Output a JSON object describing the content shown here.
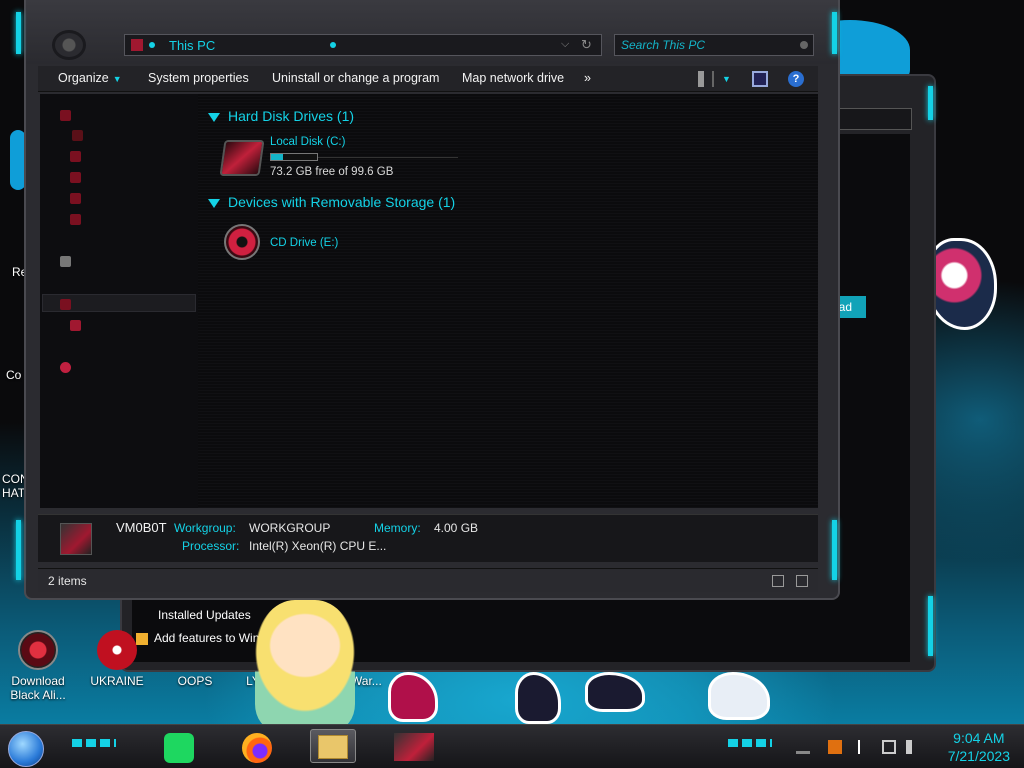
{
  "window": {
    "address_crumb": "This PC",
    "search_placeholder": "Search This PC"
  },
  "toolbar": {
    "organize": "Organize",
    "system_properties": "System properties",
    "uninstall": "Uninstall or change a program",
    "map_network": "Map network drive",
    "more": "»"
  },
  "groups": [
    {
      "title": "Hard Disk Drives (1)"
    },
    {
      "title": "Devices with Removable Storage (1)"
    }
  ],
  "drives": {
    "c": {
      "name": "Local Disk (C:)",
      "free_text": "73.2 GB free of 99.6 GB",
      "used_fraction": 0.27
    },
    "e": {
      "name": "CD Drive (E:)"
    }
  },
  "details": {
    "computer_name": "VM0B0T",
    "workgroup_label": "Workgroup:",
    "workgroup_value": "WORKGROUP",
    "memory_label": "Memory:",
    "memory_value": "4.00 GB",
    "processor_label": "Processor:",
    "processor_value": "Intel(R) Xeon(R) CPU E..."
  },
  "status": {
    "item_count": "2 items"
  },
  "back_window": {
    "button_label": "oad",
    "list_items": [
      "Installed Updates",
      "Add features to Win"
    ]
  },
  "desktop_icons": [
    {
      "label": "Download Black Ali..."
    },
    {
      "label": "UKRAINE"
    },
    {
      "label": "OOPS"
    },
    {
      "label": "LY"
    },
    {
      "label": "somWar..."
    }
  ],
  "left_edge_labels": [
    "Re",
    "Co",
    "CON HAT"
  ],
  "taskbar": {
    "time": "9:04 AM",
    "date": "7/21/2023"
  },
  "colors": {
    "accent": "#14d2e6",
    "window_bg": "#0b0b0d",
    "frame": "#2b2b30"
  }
}
